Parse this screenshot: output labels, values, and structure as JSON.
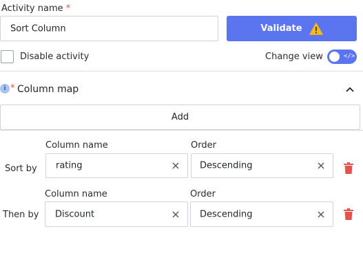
{
  "activity": {
    "name_label": "Activity name",
    "required_mark": "*",
    "name_value": "Sort Column"
  },
  "validate": {
    "label": "Validate"
  },
  "disable": {
    "label": "Disable activity"
  },
  "view": {
    "label": "Change view",
    "toggle_glyph": "</>"
  },
  "column_map": {
    "info_glyph": "i",
    "required_mark": "*",
    "title": "Column map",
    "add_label": "Add"
  },
  "rows": [
    {
      "row_label": "Sort by",
      "column_header": "Column name",
      "order_header": "Order",
      "column_value": "rating",
      "order_value": "Descending"
    },
    {
      "row_label": "Then by",
      "column_header": "Column name",
      "order_header": "Order",
      "column_value": "Discount",
      "order_value": "Descending"
    }
  ],
  "colors": {
    "accent": "#5b74f0",
    "warning": "#f5b81c",
    "danger": "#e2554f"
  }
}
